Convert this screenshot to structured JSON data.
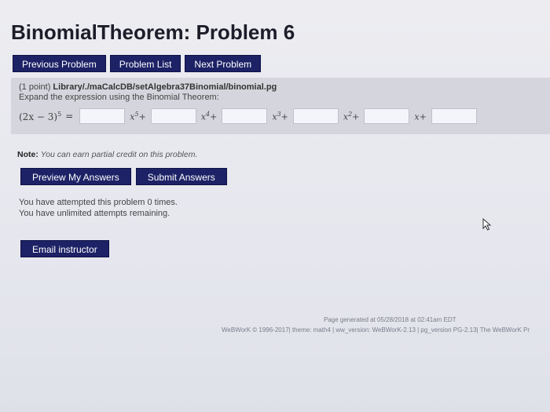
{
  "header": {
    "title": "BinomialTheorem: Problem 6"
  },
  "nav": {
    "previous_label": "Previous Problem",
    "list_label": "Problem List",
    "next_label": "Next Problem"
  },
  "problem": {
    "points": "(1 point)",
    "path": "Library/./maCalcDB/setAlgebra37Binomial/binomial.pg",
    "instruction": "Expand the expression using the Binomial Theorem:",
    "expression": "(2x − 3)",
    "expression_exp": "5",
    "equals": "=",
    "terms": [
      {
        "base": "x",
        "exp": "5",
        "op": "+"
      },
      {
        "base": "x",
        "exp": "4",
        "op": "+"
      },
      {
        "base": "x",
        "exp": "3",
        "op": "+"
      },
      {
        "base": "x",
        "exp": "2",
        "op": "+"
      },
      {
        "base": "x",
        "exp": "",
        "op": "+"
      }
    ]
  },
  "note": {
    "label": "Note:",
    "text": "You can earn partial credit on this problem."
  },
  "actions": {
    "preview_label": "Preview My Answers",
    "submit_label": "Submit Answers"
  },
  "status": {
    "attempted": "You have attempted this problem 0 times.",
    "remaining": "You have unlimited attempts remaining."
  },
  "email": {
    "label": "Email instructor"
  },
  "footer": {
    "generated": "Page generated at 05/28/2018 at 02:41am EDT",
    "credits": "WeBWorK © 1996-2017| theme: math4 | ww_version: WeBWorK-2.13 | pg_version PG-2.13| The WeBWorK Pr"
  }
}
